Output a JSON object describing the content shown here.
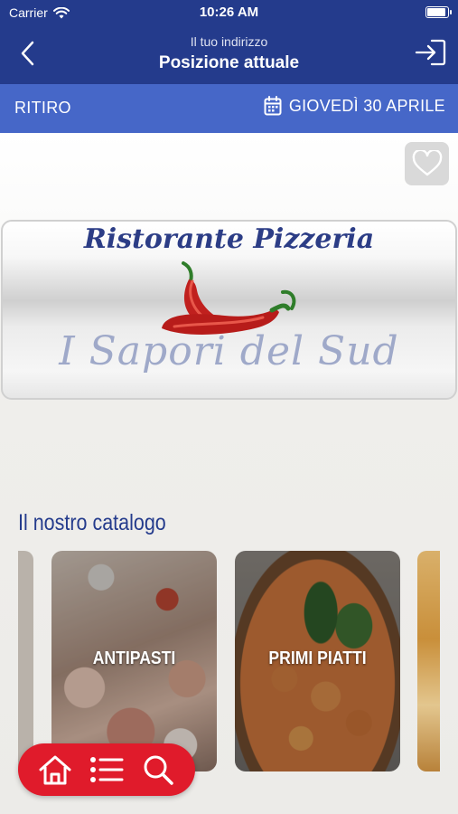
{
  "status_bar": {
    "carrier": "Carrier",
    "time": "10:26 AM",
    "battery_level": 0.92
  },
  "nav": {
    "subtitle": "Il tuo indirizzo",
    "title": "Posizione attuale",
    "back_icon": "chevron-left-icon",
    "login_icon": "sign-in-icon"
  },
  "mode_bar": {
    "mode": "RITIRO",
    "date": "GIOVEDÌ 30 APRILE",
    "date_icon": "calendar-icon"
  },
  "restaurant": {
    "logo_line1": "Ristorante Pizzeria",
    "logo_line2": "I Sapori del Sud",
    "favorite_icon": "heart-icon"
  },
  "catalog": {
    "title": "Il nostro catalogo",
    "categories": [
      {
        "label": "ANTIPASTI"
      },
      {
        "label": "PRIMI PIATTI"
      }
    ]
  },
  "toolbar": {
    "items": [
      "home-icon",
      "list-icon",
      "search-icon"
    ]
  },
  "colors": {
    "header": "#243b8c",
    "mode_bar": "#4667c8",
    "accent_red": "#e01b2b"
  }
}
